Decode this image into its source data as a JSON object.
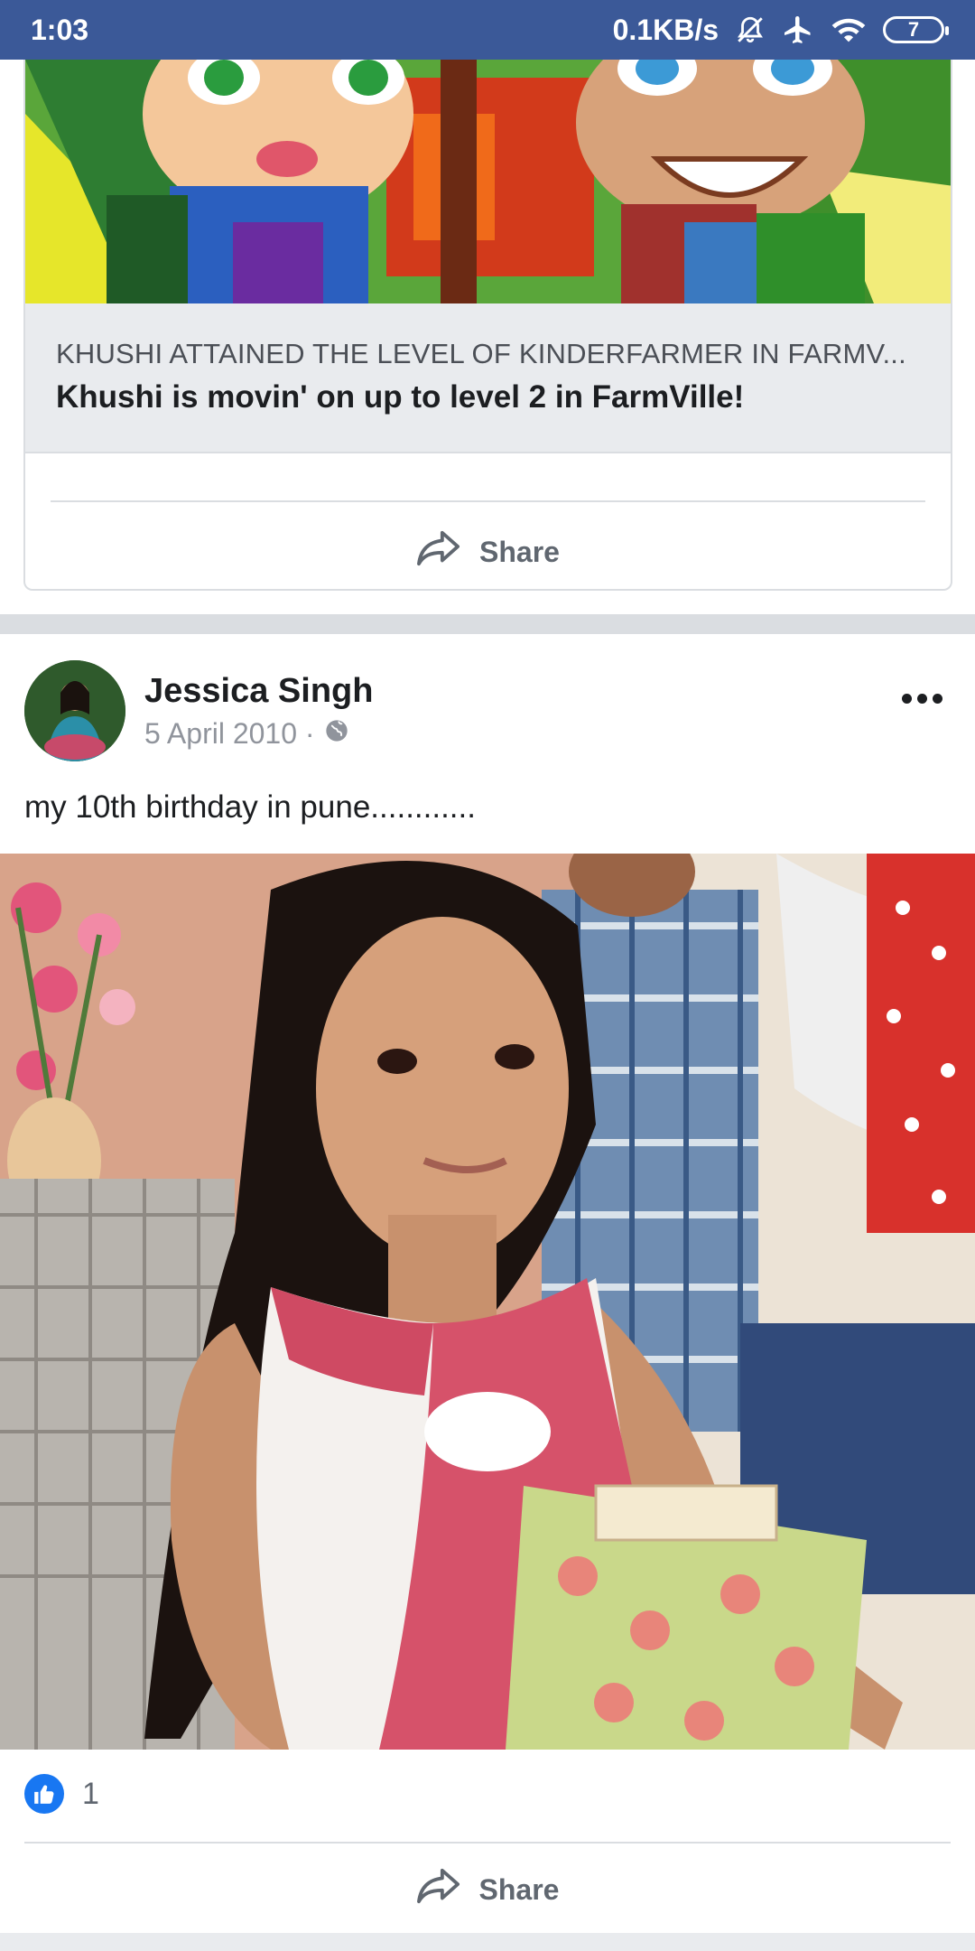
{
  "status_bar": {
    "time": "1:03",
    "network_speed": "0.1KB/s",
    "battery": "7"
  },
  "shared_post": {
    "game_subtitle": "KHUSHI ATTAINED THE LEVEL OF KINDERFARMER IN FARMV...",
    "game_title": "Khushi is movin' on up to level 2 in FarmVille!",
    "share_label": "Share"
  },
  "post": {
    "author": "Jessica Singh",
    "date": "5 April 2010 ·",
    "text": "my 10th birthday in pune............",
    "like_count": "1",
    "share_label": "Share"
  },
  "colors": {
    "brand": "#3b5998",
    "like_blue": "#1877f2",
    "secondary_text": "#606770"
  }
}
